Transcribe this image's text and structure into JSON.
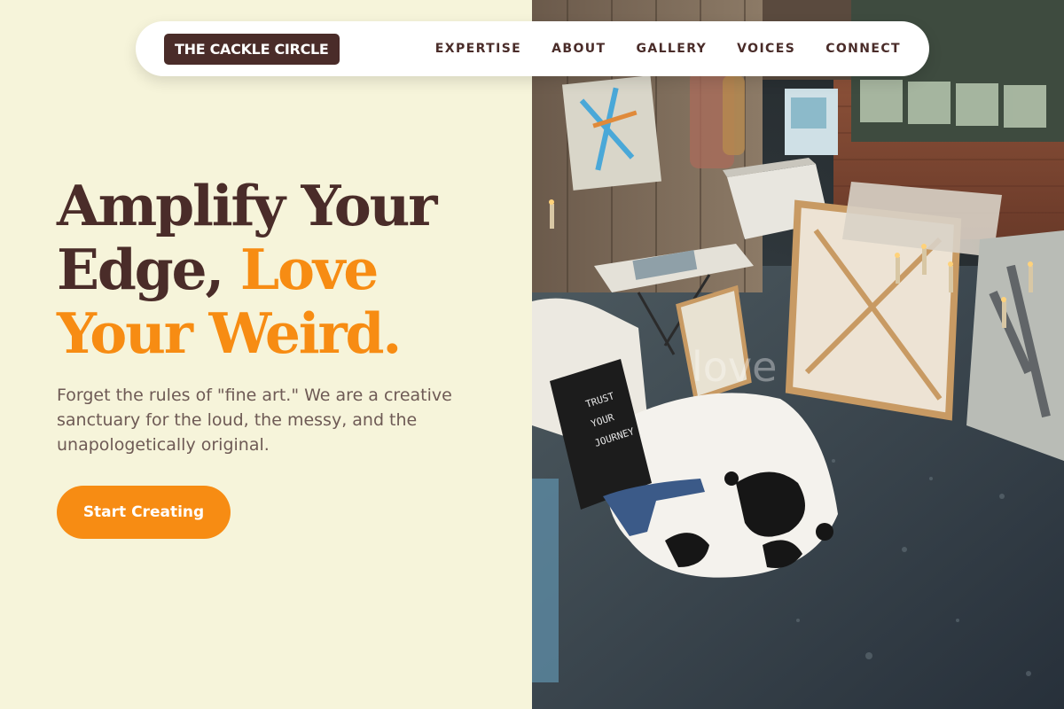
{
  "brand": {
    "name": "THE CACKLE CIRCLE"
  },
  "nav": {
    "links": [
      "EXPERTISE",
      "ABOUT",
      "GALLERY",
      "VOICES",
      "CONNECT"
    ]
  },
  "hero": {
    "headline_part1": "Amplify Your Edge,",
    "headline_accent": "Love Your Weird.",
    "subtext": "Forget the rules of \"fine art.\" We are a creative sanctuary for the loud, the messy, and the unapologetically original.",
    "cta_label": "Start Creating"
  },
  "photo": {
    "letterboard_text": "TRUST YOUR JOURNEY",
    "canvas_text": "love"
  },
  "colors": {
    "background": "#f6f4da",
    "brown": "#4a2c29",
    "accent": "#f78c13",
    "body_text": "#6e5a55"
  }
}
